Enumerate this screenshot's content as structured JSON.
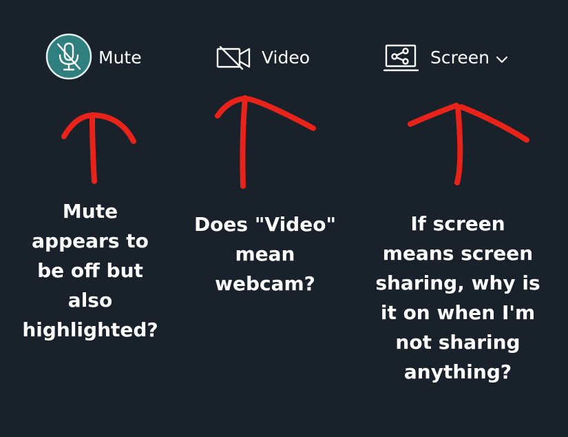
{
  "toolbar": {
    "mute": {
      "label": "Mute",
      "icon": "microphone-off-icon",
      "state": "highlighted"
    },
    "video": {
      "label": "Video",
      "icon": "video-off-icon"
    },
    "screen": {
      "label": "Screen",
      "icon": "screen-share-icon",
      "dropdown_icon": "chevron-down-icon"
    }
  },
  "annotations": {
    "mute": [
      "Mute",
      "appears to",
      "be off but",
      "also",
      "highlighted?"
    ],
    "video": [
      "Does \"Video\"",
      "mean",
      "webcam?"
    ],
    "screen": [
      "If screen",
      "means screen",
      "sharing, why is",
      "it on when I'm",
      "not sharing",
      "anything?"
    ]
  },
  "colors": {
    "background": "#19212b",
    "mute_highlight": "#2f7f7f",
    "arrow": "#e8231a",
    "text": "#ffffff"
  }
}
